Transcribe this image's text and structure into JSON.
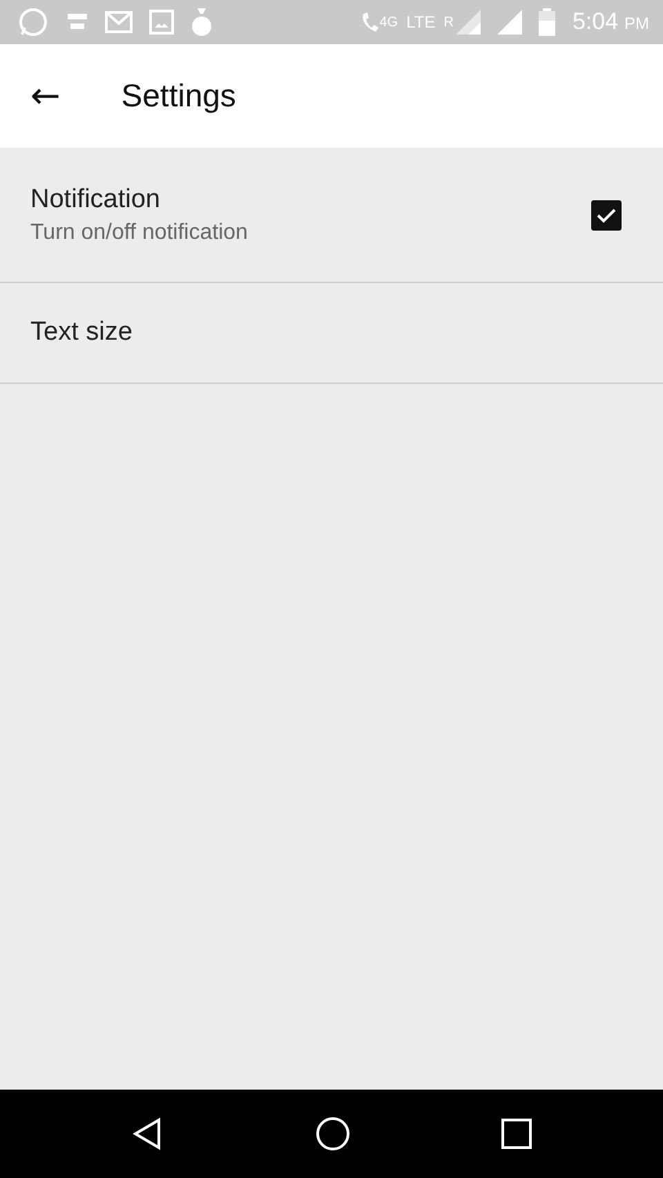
{
  "status_bar": {
    "network": "4G",
    "lte": "LTE",
    "roaming": "R",
    "time": "5:04",
    "ampm": "PM"
  },
  "app_bar": {
    "back": "←",
    "title": "Settings"
  },
  "settings": [
    {
      "kind": "checkbox",
      "title": "Notification",
      "summary": "Turn on/off notification",
      "checked": true
    },
    {
      "kind": "plain",
      "title": "Text size"
    }
  ]
}
